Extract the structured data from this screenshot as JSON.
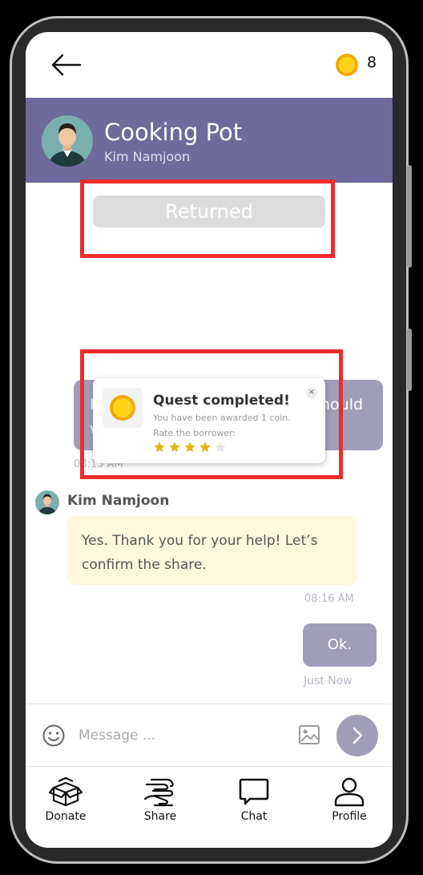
{
  "topbar": {
    "coin_count": "8"
  },
  "header": {
    "title": "Cooking Pot",
    "subtitle": "Kim Namjoon"
  },
  "status": {
    "label": "Returned"
  },
  "messages": {
    "mine_big": {
      "frag1": "I",
      "frag2": "hould",
      "frag3": "w",
      "time": "08:15 AM"
    },
    "their": {
      "sender": "Kim Namjoon",
      "text": "Yes. Thank you for your help! Let’s confirm the share.",
      "time": "08:16 AM"
    },
    "mine_ok": {
      "text": "Ok.",
      "time": "Just Now"
    }
  },
  "toast": {
    "title": "Quest completed!",
    "message": "You have been awarded 1 coin.",
    "rate_label": "Rate the borrower:",
    "rating": 4,
    "max_rating": 5,
    "close": "×"
  },
  "composer": {
    "placeholder": "Message ..."
  },
  "nav": {
    "donate": "Donate",
    "share": "Share",
    "chat": "Chat",
    "profile": "Profile"
  },
  "colors": {
    "accent": "#6e6a9b",
    "bubble_mine": "#a09db9",
    "bubble_their": "#fff8dc",
    "coin": "#f5b800",
    "highlight": "#ee2b2b"
  }
}
